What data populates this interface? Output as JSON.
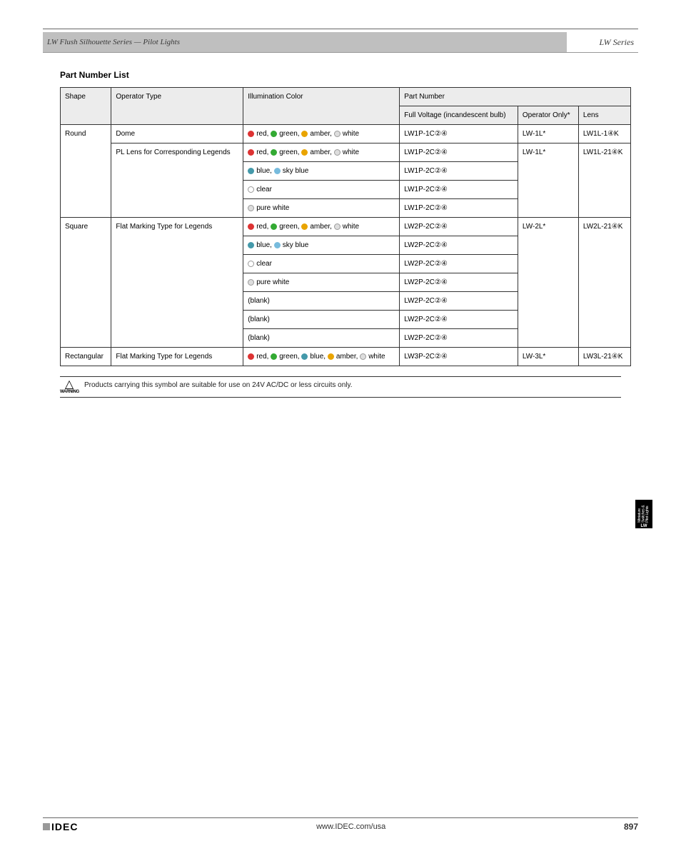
{
  "banner": {
    "left": "LW Flush Silhouette Series — Pilot Lights",
    "right": "LW Series"
  },
  "section_title": "Part Number List",
  "table": {
    "headers": {
      "shape": "Shape",
      "type": "Operator Type",
      "illum": "Illumination Color",
      "pn_group": "Part Number",
      "bulb": "Full Voltage (incandescent bulb)",
      "operator": "Operator Only*",
      "lens": "Lens"
    },
    "rows": [
      {
        "shape": "Round",
        "type_groups": [
          {
            "type": "Dome",
            "illum_rows": [
              {
                "illum_html": "<span class='colorbox c-red'></span>red, <span class='colorbox c-green'></span>green, <span class='colorbox c-amber'></span>amber, <span class='colorbox c-pw'></span>white",
                "bulb": "LW1P-1C②④"
              }
            ],
            "operator": "LW-1L*",
            "lens": "LW1L-1④K"
          },
          {
            "type": "PL Lens for Corresponding Legends",
            "illum_rows": [
              {
                "illum_html": "<span class='colorbox c-red'></span>red, <span class='colorbox c-green'></span>green, <span class='colorbox c-amber'></span>amber, <span class='colorbox c-pw'></span>white",
                "bulb": "LW1P-2C②④"
              },
              {
                "illum_html": "<span class='colorbox c-blue'></span>blue, <span class='colorbox c-sblue'></span>sky blue",
                "bulb": "LW1P-2C②④"
              },
              {
                "illum_html": "<span class='colorbox c-clear'></span>clear",
                "bulb": "LW1P-2C②④"
              },
              {
                "illum_html": "<span class='colorbox c-pw'></span>pure white",
                "bulb": "LW1P-2C②④"
              }
            ],
            "operator": "LW-1L*",
            "lens": "LW1L-21④K"
          }
        ]
      },
      {
        "shape": "Square",
        "type_groups": [
          {
            "type": "Flat Marking Type for Legends",
            "illum_rows": [
              {
                "illum_html": "<span class='colorbox c-red'></span>red, <span class='colorbox c-green'></span>green, <span class='colorbox c-amber'></span>amber, <span class='colorbox c-pw'></span>white",
                "bulb": "LW2P-2C②④"
              },
              {
                "illum_html": "<span class='colorbox c-blue'></span>blue, <span class='colorbox c-sblue'></span>sky blue",
                "bulb": "LW2P-2C②④"
              },
              {
                "illum_html": "<span class='colorbox c-clear'></span>clear",
                "bulb": "LW2P-2C②④"
              },
              {
                "illum_html": "<span class='colorbox c-pw'></span>pure white",
                "bulb": "LW2P-2C②④"
              },
              {
                "illum_html": "(blank)",
                "bulb": "LW2P-2C②④"
              },
              {
                "illum_html": "(blank)",
                "bulb": "LW2P-2C②④"
              },
              {
                "illum_html": "(blank)",
                "bulb": "LW2P-2C②④"
              }
            ],
            "operator": "LW-2L*",
            "lens": "LW2L-21④K"
          }
        ]
      },
      {
        "shape": "Rectangular",
        "type_groups": [
          {
            "type": "Flat Marking Type for Legends",
            "illum_rows": [
              {
                "illum_html": "<span class='colorbox c-red'></span>red, <span class='colorbox c-green'></span>green, <span class='colorbox c-blue'></span>blue, <span class='colorbox c-amber'></span>amber, <span class='colorbox c-pw'></span>white",
                "bulb": "LW3P-2C②④"
              }
            ],
            "operator": "LW-3L*",
            "lens": "LW3L-21④K"
          }
        ]
      }
    ]
  },
  "note": "Products carrying this symbol are suitable for use on 24V AC/DC or less circuits only.",
  "side_tab": {
    "line1": "Miniature Switches & Pilot Lights",
    "line2": "LW"
  },
  "footer": {
    "logo": "IDEC",
    "mid": "www.IDEC.com/usa",
    "page": "897"
  }
}
